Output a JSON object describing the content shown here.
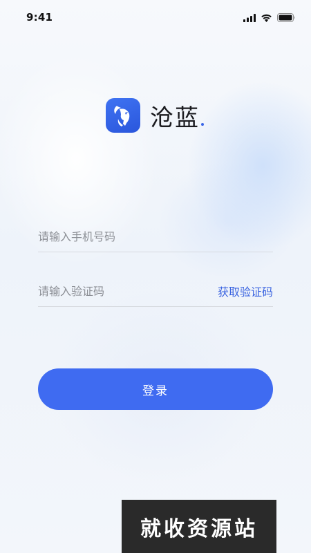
{
  "status_bar": {
    "time": "9:41",
    "icons": [
      "cellular-signal-icon",
      "wifi-icon",
      "battery-icon"
    ]
  },
  "logo": {
    "brand_name": "沧蓝",
    "icon": "goat-head-icon",
    "accent_color": "#3f6bf1"
  },
  "form": {
    "phone": {
      "placeholder": "请输入手机号码",
      "value": ""
    },
    "code": {
      "placeholder": "请输入验证码",
      "value": "",
      "get_code_label": "获取验证码"
    },
    "login_label": "登录"
  },
  "watermark": {
    "text": "就收资源站"
  }
}
